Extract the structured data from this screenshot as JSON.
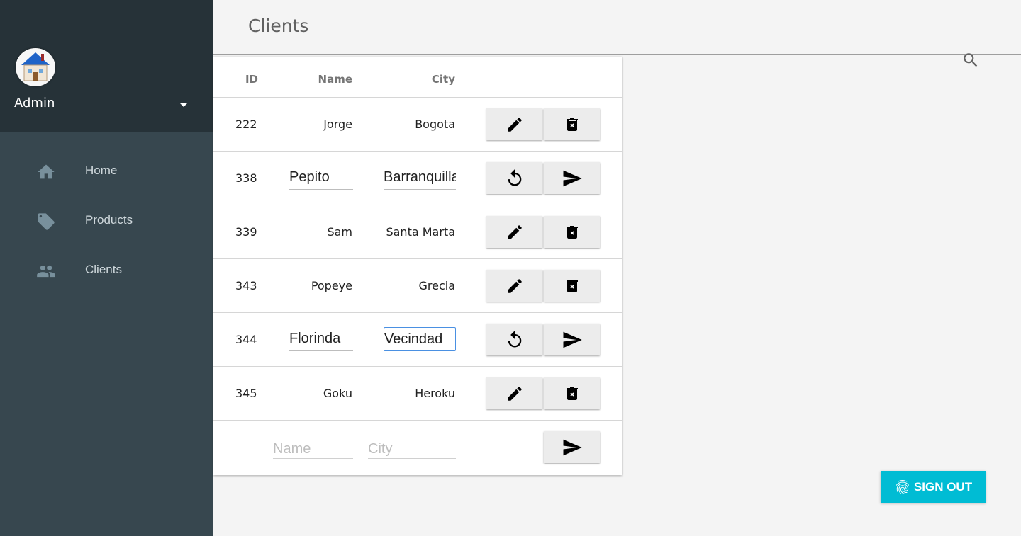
{
  "user": {
    "name": "Admin"
  },
  "nav": {
    "items": [
      {
        "label": "Home",
        "icon": "home-icon"
      },
      {
        "label": "Products",
        "icon": "tag-icon"
      },
      {
        "label": "Clients",
        "icon": "people-icon"
      }
    ]
  },
  "page": {
    "title": "Clients"
  },
  "table": {
    "headers": {
      "id": "ID",
      "name": "Name",
      "city": "City"
    },
    "rows": [
      {
        "id": "222",
        "name": "Jorge",
        "city": "Bogota",
        "mode": "view"
      },
      {
        "id": "338",
        "name": "Pepito",
        "city": "Barranquilla",
        "mode": "edit"
      },
      {
        "id": "339",
        "name": "Sam",
        "city": "Santa Marta",
        "mode": "view"
      },
      {
        "id": "343",
        "name": "Popeye",
        "city": "Grecia",
        "mode": "view"
      },
      {
        "id": "344",
        "name": "Florinda",
        "city": "Vecindad",
        "mode": "edit"
      },
      {
        "id": "345",
        "name": "Goku",
        "city": "Heroku",
        "mode": "view"
      }
    ],
    "new_row": {
      "name_placeholder": "Name",
      "city_placeholder": "City"
    }
  },
  "signout": {
    "label": "SIGN OUT"
  },
  "colors": {
    "sidebar": "#37474f",
    "sidebar_header": "#263238",
    "accent": "#00bcd4",
    "focus": "#4a90e2"
  }
}
